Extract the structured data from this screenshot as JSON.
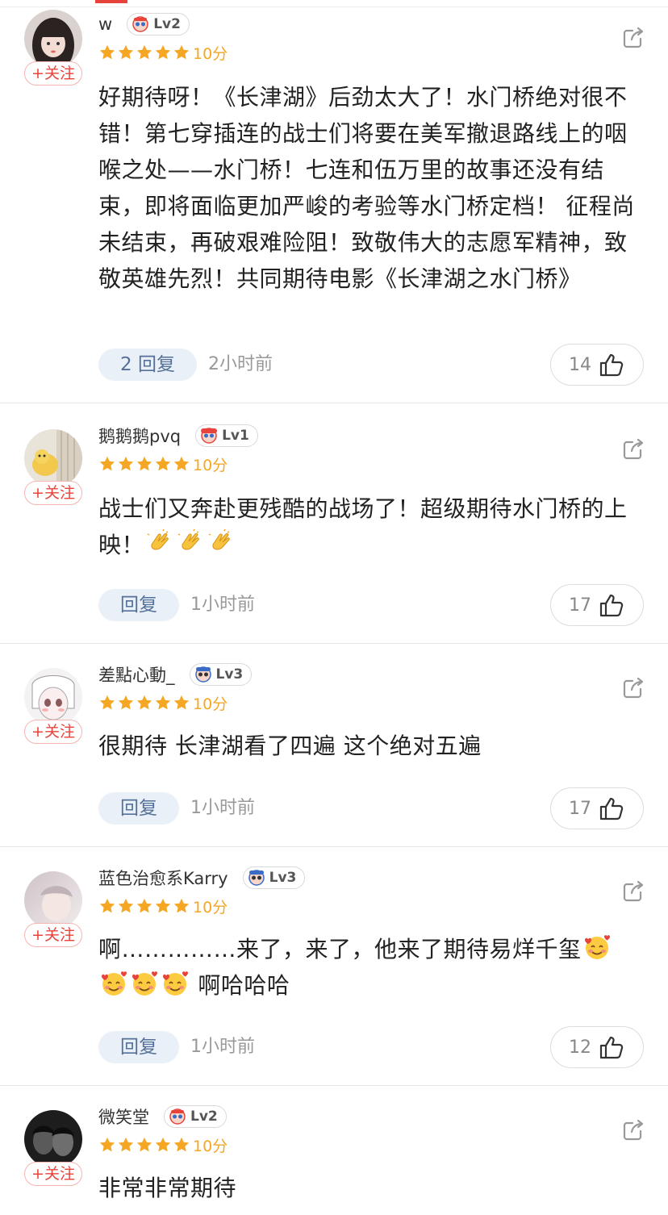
{
  "colors": {
    "accent_red": "#e8433a",
    "star_gold": "#f5a623",
    "reply_bg": "#eaf0f7",
    "reply_text": "#557199"
  },
  "follow_label": "+关注",
  "comments": [
    {
      "username": "w",
      "level": "Lv2",
      "score": "10分",
      "stars": 5,
      "text": "好期待呀！《长津湖》后劲太大了！水门桥绝对很不错！第七穿插连的战士们将要在美军撤退路线上的咽喉之处——水门桥！七连和伍万里的故事还没有结束，即将面临更加严峻的考验等水门桥定档！ 征程尚未结束，再破艰难险阻！致敬伟大的志愿军精神，致敬英雄先烈！共同期待电影《长津湖之水门桥》",
      "reply_label": "2 回复",
      "time": "2小时前",
      "likes": "14"
    },
    {
      "username": "鹅鹅鹅pvq",
      "level": "Lv1",
      "score": "10分",
      "stars": 5,
      "text": "战士们又奔赴更残酷的战场了！超级期待水门桥的上映！",
      "emoji_suffix": [
        "clap-emoji",
        "clap-emoji",
        "clap-emoji"
      ],
      "reply_label": "回复",
      "time": "1小时前",
      "likes": "17"
    },
    {
      "username": "差點心動_",
      "level": "Lv3",
      "score": "10分",
      "stars": 5,
      "text": "很期待 长津湖看了四遍 这个绝对五遍",
      "reply_label": "回复",
      "time": "1小时前",
      "likes": "17"
    },
    {
      "username": "蓝色治愈系Karry",
      "level": "Lv3",
      "score": "10分",
      "stars": 5,
      "text_line1": "啊……………来了，来了，他来了期待易烊千玺",
      "text_line2": "啊哈哈哈",
      "reply_label": "回复",
      "time": "1小时前",
      "likes": "12"
    },
    {
      "username": "微笑堂",
      "level": "Lv2",
      "score": "10分",
      "stars": 5,
      "text": "非常非常期待"
    }
  ]
}
